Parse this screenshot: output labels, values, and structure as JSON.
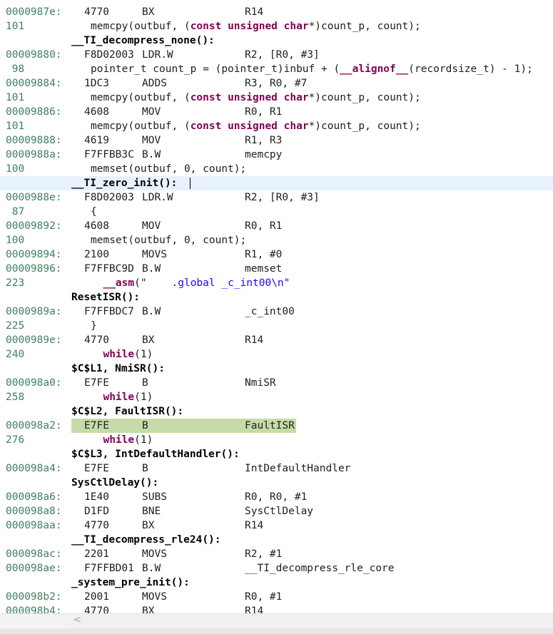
{
  "rows": [
    {
      "kind": "asm",
      "addr": "0000987e:",
      "op": "4770",
      "mn": "BX",
      "args": "R14"
    },
    {
      "kind": "src",
      "line": "101",
      "parts": [
        [
          "memcpy(outbuf, (",
          ""
        ],
        [
          "const",
          "kw"
        ],
        [
          " ",
          ""
        ],
        [
          "unsigned",
          "kw"
        ],
        [
          " ",
          ""
        ],
        [
          "char",
          "kw"
        ],
        [
          "*)count_p, count);",
          ""
        ]
      ]
    },
    {
      "kind": "label",
      "text": "__TI_decompress_none():"
    },
    {
      "kind": "asm",
      "addr": "00009880:",
      "op": "F8D02003",
      "mn": "LDR.W",
      "args": "R2, [R0, #3]"
    },
    {
      "kind": "src",
      "line": " 98",
      "parts": [
        [
          "pointer_t count_p = (pointer_t)inbuf + (",
          ""
        ],
        [
          "__alignof__",
          "kw"
        ],
        [
          "(recordsize_t) - 1);",
          ""
        ]
      ]
    },
    {
      "kind": "asm",
      "addr": "00009884:",
      "op": "1DC3",
      "mn": "ADDS",
      "args": "R3, R0, #7"
    },
    {
      "kind": "src",
      "line": "101",
      "parts": [
        [
          "memcpy(outbuf, (",
          ""
        ],
        [
          "const",
          "kw"
        ],
        [
          " ",
          ""
        ],
        [
          "unsigned",
          "kw"
        ],
        [
          " ",
          ""
        ],
        [
          "char",
          "kw"
        ],
        [
          "*)count_p, count);",
          ""
        ]
      ]
    },
    {
      "kind": "asm",
      "addr": "00009886:",
      "op": "4608",
      "mn": "MOV",
      "args": "R0, R1"
    },
    {
      "kind": "src",
      "line": "101",
      "parts": [
        [
          "memcpy(outbuf, (",
          ""
        ],
        [
          "const",
          "kw"
        ],
        [
          " ",
          ""
        ],
        [
          "unsigned",
          "kw"
        ],
        [
          " ",
          ""
        ],
        [
          "char",
          "kw"
        ],
        [
          "*)count_p, count);",
          ""
        ]
      ]
    },
    {
      "kind": "asm",
      "addr": "00009888:",
      "op": "4619",
      "mn": "MOV",
      "args": "R1, R3"
    },
    {
      "kind": "asm",
      "addr": "0000988a:",
      "op": "F7FFBB3C",
      "mn": "B.W",
      "args": "memcpy"
    },
    {
      "kind": "src",
      "line": "100",
      "parts": [
        [
          "memset(outbuf, 0, count);",
          ""
        ]
      ]
    },
    {
      "kind": "label",
      "text": "__TI_zero_init():",
      "current": true
    },
    {
      "kind": "asm",
      "addr": "0000988e:",
      "op": "F8D02003",
      "mn": "LDR.W",
      "args": "R2, [R0, #3]"
    },
    {
      "kind": "src",
      "line": " 87",
      "parts": [
        [
          "{",
          ""
        ]
      ],
      "shift": true
    },
    {
      "kind": "asm",
      "addr": "00009892:",
      "op": "4608",
      "mn": "MOV",
      "args": "R0, R1"
    },
    {
      "kind": "src",
      "line": "100",
      "parts": [
        [
          "memset(outbuf, 0, count);",
          ""
        ]
      ]
    },
    {
      "kind": "asm",
      "addr": "00009894:",
      "op": "2100",
      "mn": "MOVS",
      "args": "R1, #0"
    },
    {
      "kind": "asm",
      "addr": "00009896:",
      "op": "F7FFBC9D",
      "mn": "B.W",
      "args": "memset"
    },
    {
      "kind": "src",
      "line": "223",
      "parts": [
        [
          "  ",
          ""
        ],
        [
          "__asm",
          "kw"
        ],
        [
          "(\"    ",
          ""
        ],
        [
          ".global _c_int00\\n\"",
          "str"
        ]
      ]
    },
    {
      "kind": "label",
      "text": "ResetISR():"
    },
    {
      "kind": "asm",
      "addr": "0000989a:",
      "op": "F7FFBDC7",
      "mn": "B.W",
      "args": "_c_int00"
    },
    {
      "kind": "src",
      "line": "225",
      "parts": [
        [
          "}",
          ""
        ]
      ],
      "shift": true
    },
    {
      "kind": "asm",
      "addr": "0000989e:",
      "op": "4770",
      "mn": "BX",
      "args": "R14"
    },
    {
      "kind": "src",
      "line": "240",
      "parts": [
        [
          "  ",
          ""
        ],
        [
          "while",
          "kw"
        ],
        [
          "(1)",
          ""
        ]
      ]
    },
    {
      "kind": "label",
      "text": "$C$L1, NmiSR():"
    },
    {
      "kind": "asm",
      "addr": "000098a0:",
      "op": "E7FE",
      "mn": "B",
      "args": "NmiSR"
    },
    {
      "kind": "src",
      "line": "258",
      "parts": [
        [
          "  ",
          ""
        ],
        [
          "while",
          "kw"
        ],
        [
          "(1)",
          ""
        ]
      ]
    },
    {
      "kind": "label",
      "text": "$C$L2, FaultISR():"
    },
    {
      "kind": "asm",
      "addr": "000098a2:",
      "op": "E7FE",
      "mn": "B",
      "args": "FaultISR",
      "highlight": true
    },
    {
      "kind": "src",
      "line": "276",
      "parts": [
        [
          "  ",
          ""
        ],
        [
          "while",
          "kw"
        ],
        [
          "(1)",
          ""
        ]
      ]
    },
    {
      "kind": "label",
      "text": "$C$L3, IntDefaultHandler():"
    },
    {
      "kind": "asm",
      "addr": "000098a4:",
      "op": "E7FE",
      "mn": "B",
      "args": "IntDefaultHandler"
    },
    {
      "kind": "label",
      "text": "SysCtlDelay():"
    },
    {
      "kind": "asm",
      "addr": "000098a6:",
      "op": "1E40",
      "mn": "SUBS",
      "args": "R0, R0, #1"
    },
    {
      "kind": "asm",
      "addr": "000098a8:",
      "op": "D1FD",
      "mn": "BNE",
      "args": "SysCtlDelay"
    },
    {
      "kind": "asm",
      "addr": "000098aa:",
      "op": "4770",
      "mn": "BX",
      "args": "R14"
    },
    {
      "kind": "label",
      "text": "__TI_decompress_rle24():"
    },
    {
      "kind": "asm",
      "addr": "000098ac:",
      "op": "2201",
      "mn": "MOVS",
      "args": "R2, #1"
    },
    {
      "kind": "asm",
      "addr": "000098ae:",
      "op": "F7FFBD01",
      "mn": "B.W",
      "args": "__TI_decompress_rle_core"
    },
    {
      "kind": "label",
      "text": "_system_pre_init():"
    },
    {
      "kind": "asm",
      "addr": "000098b2:",
      "op": "2001",
      "mn": "MOVS",
      "args": "R0, #1"
    },
    {
      "kind": "asm",
      "addr": "000098b4:",
      "op": "4770",
      "mn": "BX",
      "args": "R14"
    }
  ],
  "scrollbar": {
    "left_arrow_icon": "chevron-left-icon",
    "left_arrow_glyph": "<"
  },
  "colors": {
    "address": "#3f7f5f",
    "keyword": "#7f0055",
    "string": "#2a00ff",
    "current_line": "#e8f2fe",
    "pc_highlight": "#c7dba8"
  }
}
